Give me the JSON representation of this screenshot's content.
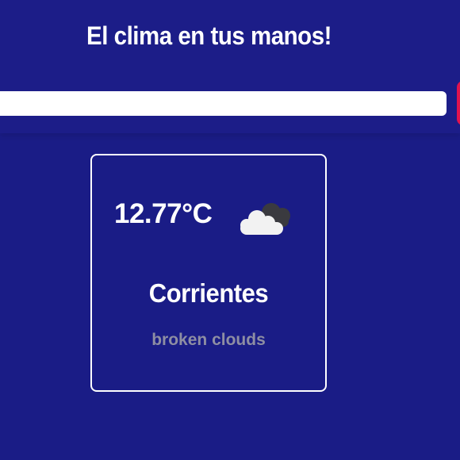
{
  "header": {
    "title": "El clima en tus manos!"
  },
  "search": {
    "value": "",
    "placeholder": "",
    "button_icon": "search-icon"
  },
  "weather": {
    "temperature": "12.77°C",
    "icon": "broken-clouds-icon",
    "city": "Corrientes",
    "description": "broken clouds"
  },
  "colors": {
    "background": "#1a1c86",
    "accent": "#e1134e",
    "card_border": "#ffffff",
    "description_text": "#8e8ea3"
  }
}
